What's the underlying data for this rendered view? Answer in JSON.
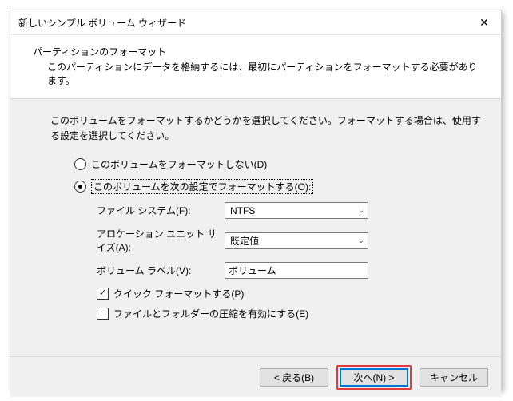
{
  "window": {
    "title": "新しいシンプル ボリューム ウィザード"
  },
  "header": {
    "heading": "パーティションのフォーマット",
    "subheading": "このパーティションにデータを格納するには、最初にパーティションをフォーマットする必要があります。"
  },
  "instruction": "このボリュームをフォーマットするかどうかを選択してください。フォーマットする場合は、使用する設定を選択してください。",
  "options": {
    "no_format": "このボリュームをフォーマットしない(D)",
    "format_with": "このボリュームを次の設定でフォーマットする(O):"
  },
  "settings": {
    "fs_label": "ファイル システム(F):",
    "fs_value": "NTFS",
    "au_label": "アロケーション ユニット サイズ(A):",
    "au_value": "既定値",
    "vol_label": "ボリューム ラベル(V):",
    "vol_value": "ボリューム"
  },
  "checks": {
    "quick": "クイック フォーマットする(P)",
    "compress": "ファイルとフォルダーの圧縮を有効にする(E)"
  },
  "footer": {
    "back": "< 戻る(B)",
    "next": "次へ(N) >",
    "cancel": "キャンセル"
  }
}
